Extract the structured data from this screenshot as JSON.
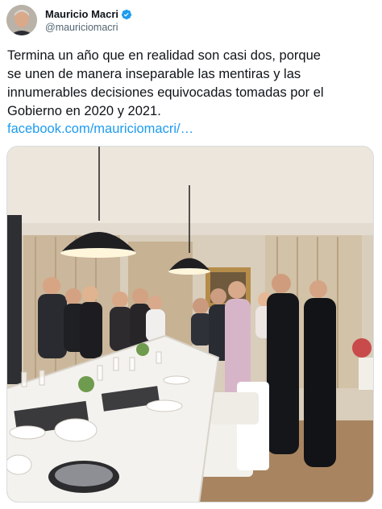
{
  "author": {
    "display_name": "Mauricio Macri",
    "handle": "@mauriciomacri",
    "verified": true,
    "verified_icon": "verified-badge-icon"
  },
  "tweet": {
    "lines": [
      "Termina un año que en realidad son casi dos, porque",
      "se unen de manera inseparable las mentiras y las",
      "innumerables decisiones equivocadas tomadas por el",
      "Gobierno en 2020 y 2021."
    ],
    "link_text": "facebook.com/mauriciomacri/…"
  },
  "colors": {
    "link": "#1d9bf0",
    "secondary_text": "#536471",
    "verified": "#1d9bf0"
  }
}
